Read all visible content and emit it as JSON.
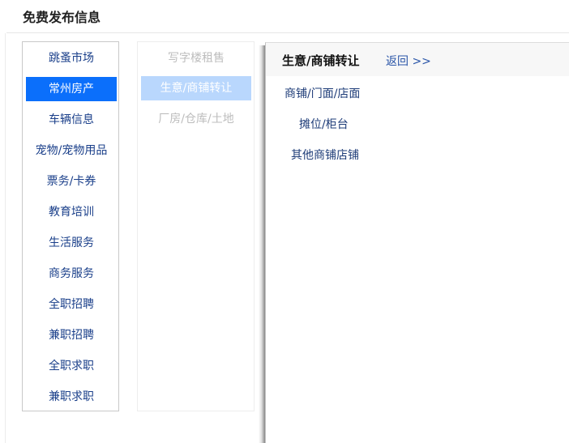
{
  "page_title": "免费发布信息",
  "category_list": [
    {
      "label": "跳蚤市场",
      "active": false
    },
    {
      "label": "常州房产",
      "active": true
    },
    {
      "label": "车辆信息",
      "active": false
    },
    {
      "label": "宠物/宠物用品",
      "active": false
    },
    {
      "label": "票务/卡券",
      "active": false
    },
    {
      "label": "教育培训",
      "active": false
    },
    {
      "label": "生活服务",
      "active": false
    },
    {
      "label": "商务服务",
      "active": false
    },
    {
      "label": "全职招聘",
      "active": false
    },
    {
      "label": "兼职招聘",
      "active": false
    },
    {
      "label": "全职求职",
      "active": false
    },
    {
      "label": "兼职求职",
      "active": false
    }
  ],
  "subcategory_list": [
    {
      "label": "写字楼租售",
      "active": false
    },
    {
      "label": "生意/商铺转让",
      "active": true
    },
    {
      "label": "厂房/仓库/土地",
      "active": false
    }
  ],
  "detail_panel": {
    "title": "生意/商铺转让",
    "back_label": "返回 >>",
    "items": [
      "商铺/门面/店面",
      "摊位/柜台",
      "其他商铺店铺"
    ]
  },
  "colors": {
    "active_category_bg": "#0b6ffb",
    "active_subcategory_bg": "#b9d7fd",
    "link_text": "#1a3f8a"
  }
}
